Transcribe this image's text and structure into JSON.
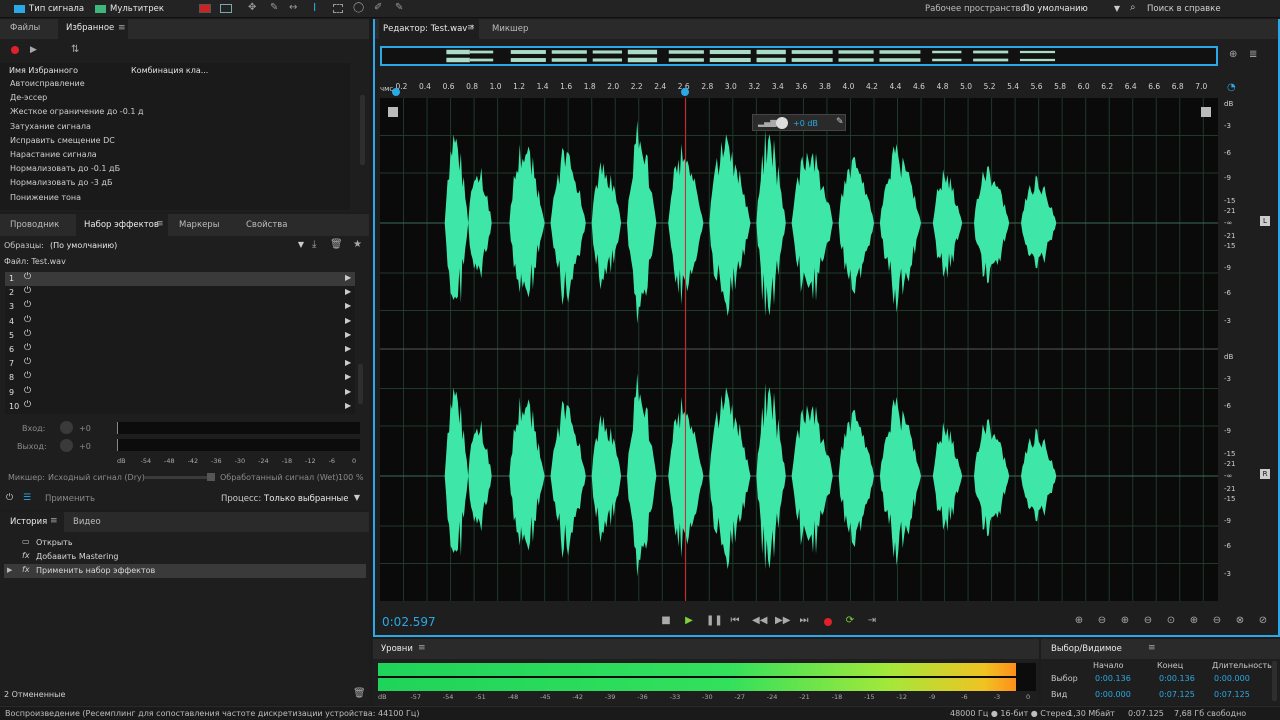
{
  "toolbar": {
    "tab_waveform": "Тип сигнала",
    "tab_multitrack": "Мультитрек",
    "workspace_label": "Рабочее пространство:",
    "workspace_value": "По умолчанию",
    "search_help": "Поиск в справке"
  },
  "favorites": {
    "tab_files": "Файлы",
    "tab_favorites": "Избранное",
    "col_name": "Имя Избранного",
    "col_shortcut": "Комбинация кла...",
    "items": [
      "Автоисправление",
      "Де-эссер",
      "Жесткое ограничение до -0.1 д",
      "Затухание сигнала",
      "Исправить смещение DC",
      "Нарастание сигнала",
      "Нормализовать до -0.1 дБ",
      "Нормализовать до -3 дБ",
      "Понижение тона"
    ]
  },
  "effects": {
    "tab_explorer": "Проводник",
    "tab_rack": "Набор эффектов",
    "tab_markers": "Маркеры",
    "tab_properties": "Свойства",
    "presets_label": "Образцы:",
    "presets_value": "(По умолчанию)",
    "file_label": "Файл: Test.wav",
    "slots": [
      "1",
      "2",
      "3",
      "4",
      "5",
      "6",
      "7",
      "8",
      "9",
      "10"
    ],
    "input_label": "Вход:",
    "input_value": "+0",
    "output_label": "Выход:",
    "output_value": "+0",
    "meter_scale": [
      "dB",
      "-54",
      "-48",
      "-42",
      "-36",
      "-30",
      "-24",
      "-18",
      "-12",
      "-6",
      "0"
    ],
    "mixer_label": "Микшер:",
    "dry_label": "Исходный сигнал (Dry)",
    "wet_label": "Обработанный сигнал (Wet)",
    "wet_value": "100 %",
    "apply_label": "Применить",
    "process_label": "Процесс:",
    "process_value": "Только выбранные"
  },
  "history": {
    "tab_history": "История",
    "tab_video": "Видео",
    "items": [
      "Открыть",
      "Добавить Mastering",
      "Применить набор эффектов"
    ],
    "undo_count": "2 Отмененные"
  },
  "editor": {
    "tab_editor": "Редактор: Test.wav *",
    "tab_mixer": "Микшер",
    "ruler_unit": "чмс",
    "ruler_ticks": [
      "0.2",
      "0.4",
      "0.6",
      "0.8",
      "1.0",
      "1.2",
      "1.4",
      "1.6",
      "1.8",
      "2.0",
      "2.2",
      "2.4",
      "2.6",
      "2.8",
      "3.0",
      "3.2",
      "3.4",
      "3.6",
      "3.8",
      "4.0",
      "4.2",
      "4.4",
      "4.6",
      "4.8",
      "5.0",
      "5.2",
      "5.4",
      "5.6",
      "5.8",
      "6.0",
      "6.2",
      "6.4",
      "6.6",
      "6.8",
      "7.0"
    ],
    "hud_gain": "+0 dB",
    "db_unit": "dB",
    "db_scale": [
      "-3",
      "-6",
      "-9",
      "-15",
      "-21",
      "-∞",
      "-21",
      "-15",
      "-9",
      "-6",
      "-3"
    ],
    "channel_left": "L",
    "channel_right": "R",
    "time_display": "0:02.597"
  },
  "levels": {
    "title": "Уровни",
    "scale": [
      "dB",
      "-57",
      "-54",
      "-51",
      "-48",
      "-45",
      "-42",
      "-39",
      "-36",
      "-33",
      "-30",
      "-27",
      "-24",
      "-21",
      "-18",
      "-15",
      "-12",
      "-9",
      "-6",
      "-3",
      "0"
    ],
    "level_fraction": 0.97
  },
  "selection": {
    "title": "Выбор/Видимое",
    "col_start": "Начало",
    "col_end": "Конец",
    "col_duration": "Длительность",
    "row_selection": "Выбор",
    "row_view": "Вид",
    "sel_start": "0:00.136",
    "sel_end": "0:00.136",
    "sel_duration": "0:00.000",
    "view_start": "0:00.000",
    "view_end": "0:07.125",
    "view_duration": "0:07.125"
  },
  "status": {
    "message": "Воспроизведение (Ресемплинг для сопоставления частоте дискретизации устройства: 44100 Гц)",
    "format": "48000 Гц ● 16-бит ● Стерео",
    "size": "1,30 Мбайт",
    "duration": "0:07.125",
    "free": "7,68 Гб свободно"
  },
  "colors": {
    "waveform": "#3ee6a8",
    "accent": "#2aa9e6",
    "playhead": "#e0202a"
  },
  "waveform": {
    "duration_s": 7.125,
    "playhead_s": 2.597,
    "segments": [
      {
        "start": 0.55,
        "end": 0.75,
        "peak": 0.9
      },
      {
        "start": 0.75,
        "end": 0.95,
        "peak": 0.55
      },
      {
        "start": 1.1,
        "end": 1.4,
        "peak": 0.78
      },
      {
        "start": 1.45,
        "end": 1.75,
        "peak": 0.7
      },
      {
        "start": 1.8,
        "end": 2.05,
        "peak": 0.62
      },
      {
        "start": 2.1,
        "end": 2.35,
        "peak": 0.9
      },
      {
        "start": 2.45,
        "end": 2.75,
        "peak": 0.7
      },
      {
        "start": 2.8,
        "end": 3.15,
        "peak": 0.82
      },
      {
        "start": 3.2,
        "end": 3.45,
        "peak": 0.88
      },
      {
        "start": 3.5,
        "end": 3.85,
        "peak": 0.75
      },
      {
        "start": 3.9,
        "end": 4.2,
        "peak": 0.68
      },
      {
        "start": 4.25,
        "end": 4.6,
        "peak": 0.7
      },
      {
        "start": 4.7,
        "end": 4.95,
        "peak": 0.5
      },
      {
        "start": 5.05,
        "end": 5.35,
        "peak": 0.55
      },
      {
        "start": 5.45,
        "end": 5.75,
        "peak": 0.45
      }
    ]
  }
}
